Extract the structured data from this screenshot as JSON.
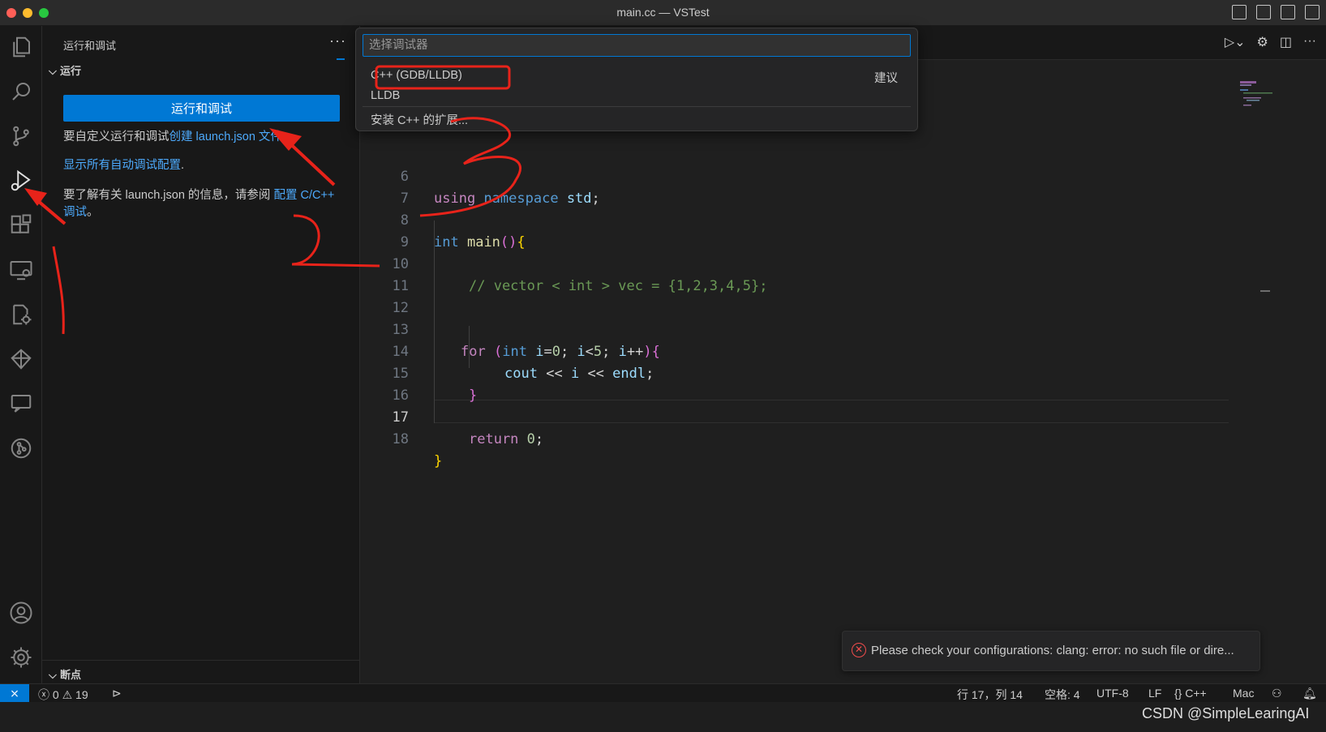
{
  "window": {
    "title": "main.cc — VSTest"
  },
  "sidebar": {
    "title": "运行和调试",
    "more": "···",
    "run_section": "运行",
    "run_button": "运行和调试",
    "customize_prefix": "要自定义运行和调试",
    "create_link": "创建 launch.json 文件",
    "customize_suffix": "。",
    "show_all_link": "显示所有自动调试配置",
    "show_all_suffix": ".",
    "learn_prefix": "要了解有关 launch.json 的信息，请参阅 ",
    "learn_link": "配置 C/C++ 调试",
    "learn_suffix": "。",
    "breakpoints_section": "断点"
  },
  "quickpick": {
    "placeholder": "选择调试器",
    "items": [
      "C++ (GDB/LLDB)",
      "LLDB",
      "安装 C++ 的扩展..."
    ],
    "hint": "建议"
  },
  "editor": {
    "lines": [
      {
        "n": "6",
        "text": "using namespace std;"
      },
      {
        "n": "7",
        "text": ""
      },
      {
        "n": "8",
        "text": "int main(){"
      },
      {
        "n": "9",
        "text": ""
      },
      {
        "n": "10",
        "text": "// vector < int > vec = {1,2,3,4,5};"
      },
      {
        "n": "11",
        "text": ""
      },
      {
        "n": "12",
        "text": ""
      },
      {
        "n": "13",
        "text": "for (int i=0; i<5; i++){"
      },
      {
        "n": "14",
        "text": "cout << i << endl;"
      },
      {
        "n": "15",
        "text": "}"
      },
      {
        "n": "16",
        "text": ""
      },
      {
        "n": "17",
        "text": "return 0;"
      },
      {
        "n": "18",
        "text": "}"
      }
    ]
  },
  "notification": {
    "message": "Please check your configurations: clang: error: no such file or dire..."
  },
  "statusbar": {
    "errors": "0",
    "warnings": "19",
    "position": "行 17，列 14",
    "spaces": "空格: 4",
    "encoding": "UTF-8",
    "eol": "LF",
    "language": "C++",
    "platform": "Mac"
  },
  "watermark": "CSDN @SimpleLearingAI",
  "colors": {
    "accent": "#0078d4",
    "annotation": "#e8231a",
    "error": "#f14c4c"
  }
}
